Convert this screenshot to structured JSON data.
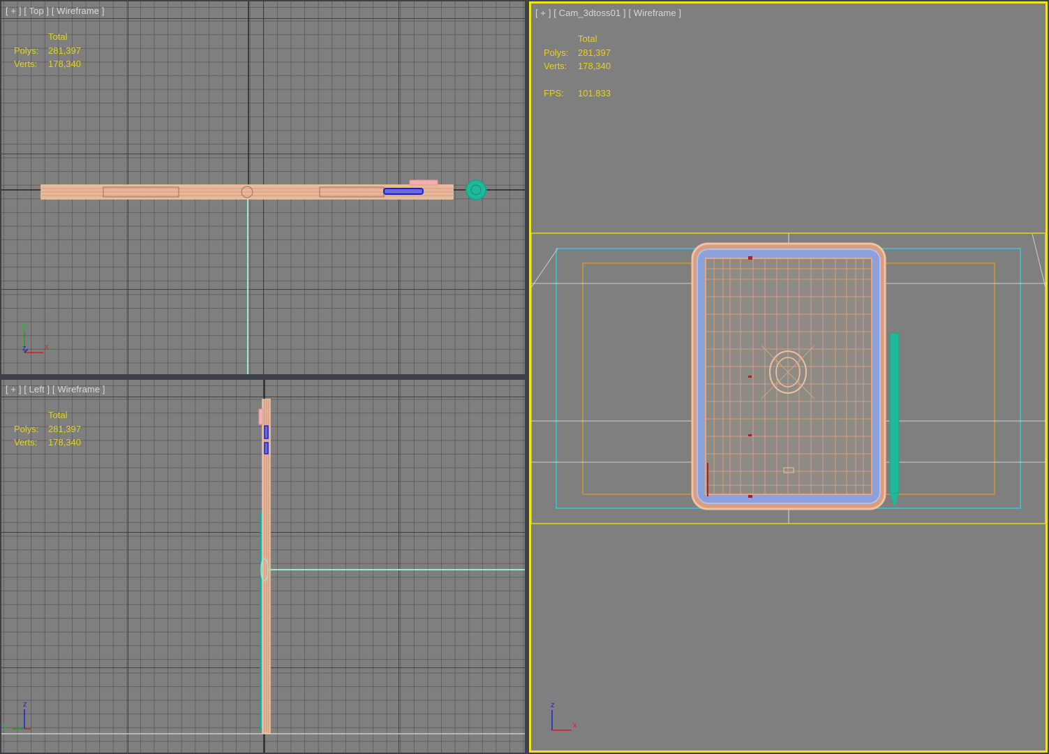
{
  "viewports": {
    "top": {
      "label": "[ + ] [ Top ] [ Wireframe ]",
      "stats": {
        "header": "Total",
        "polys_label": "Polys:",
        "polys": "281,397",
        "verts_label": "Verts:",
        "verts": "178,340"
      },
      "axis": {
        "a": "y",
        "b": "z",
        "c": "x"
      }
    },
    "left": {
      "label": "[ + ] [ Left ] [ Wireframe ]",
      "stats": {
        "header": "Total",
        "polys_label": "Polys:",
        "polys": "281,397",
        "verts_label": "Verts:",
        "verts": "178,340"
      },
      "axis": {
        "a": "z",
        "b": "y",
        "c": "x"
      }
    },
    "camera": {
      "label": "[ + ] [ Cam_3dtoss01 ] [ Wireframe ]",
      "stats": {
        "header": "Total",
        "polys_label": "Polys:",
        "polys": "281,397",
        "verts_label": "Verts:",
        "verts": "178,340",
        "fps_label": "FPS:",
        "fps": "101.833"
      },
      "axis": {
        "a": "z",
        "c": "x"
      },
      "active": true
    }
  },
  "colors": {
    "viewport_bg": "#7f7f7f",
    "active_border": "#f2e51b",
    "stats_text": "#e6d21a",
    "wire_body": "#f0b896",
    "wire_blue": "#2020c0",
    "wire_teal": "#1fb89a",
    "safe_frame_cyan": "#30c8d8",
    "safe_frame_orange": "#e0a020",
    "safe_frame_yellow": "#e6d21a"
  }
}
